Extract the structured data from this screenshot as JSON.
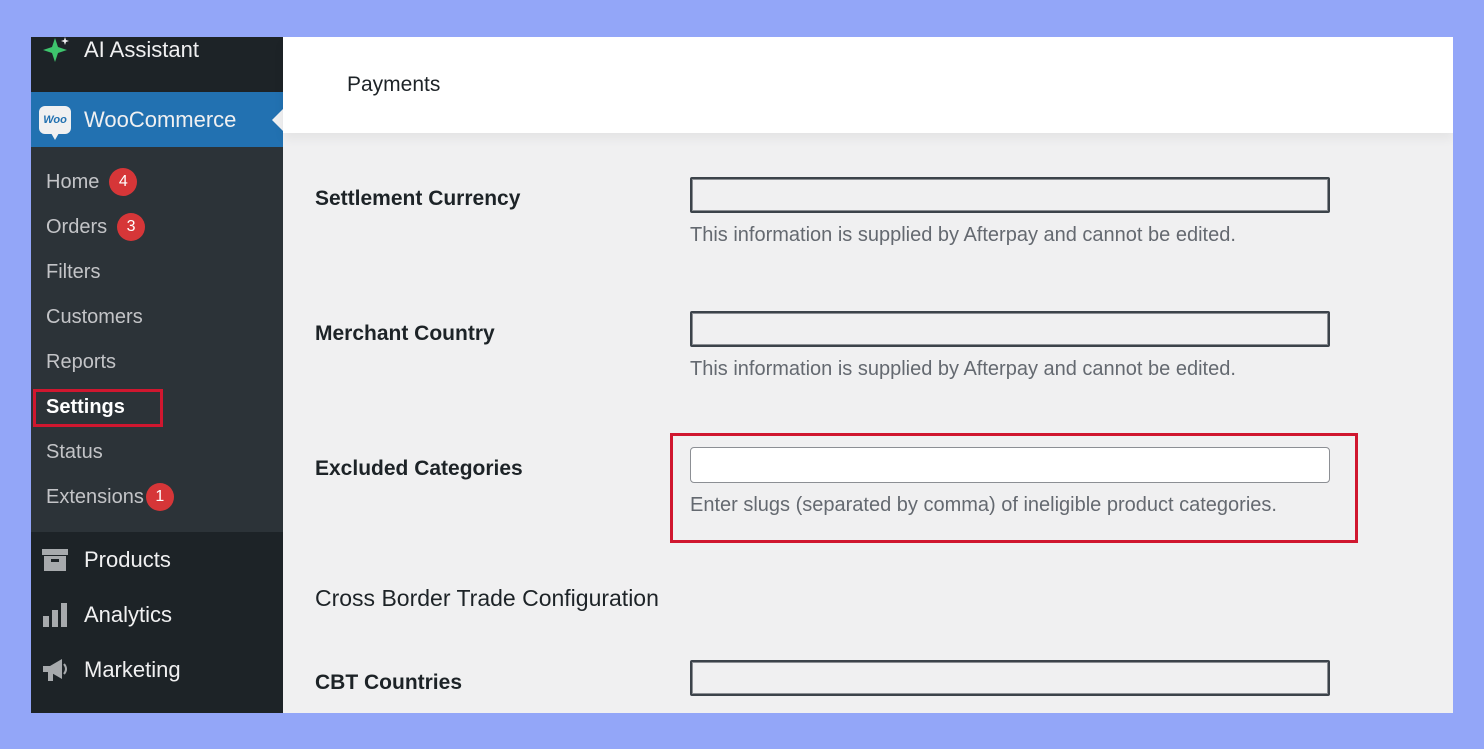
{
  "sidebar": {
    "ai_assistant": {
      "label": "AI Assistant",
      "icon": "sparkle-icon"
    },
    "woocommerce": {
      "label": "WooCommerce",
      "logo_text": "Woo"
    },
    "submenu": [
      {
        "label": "Home",
        "badge": "4"
      },
      {
        "label": "Orders",
        "badge": "3"
      },
      {
        "label": "Filters"
      },
      {
        "label": "Customers"
      },
      {
        "label": "Reports"
      },
      {
        "label": "Settings",
        "active": true
      },
      {
        "label": "Status"
      },
      {
        "label": "Extensions",
        "badge": "1"
      }
    ],
    "products": {
      "label": "Products",
      "icon": "archive-icon"
    },
    "analytics": {
      "label": "Analytics",
      "icon": "bar-chart-icon"
    },
    "marketing": {
      "label": "Marketing",
      "icon": "megaphone-icon"
    }
  },
  "header": {
    "title": "Payments"
  },
  "form": {
    "settlement_currency": {
      "label": "Settlement Currency",
      "value": "",
      "description": "This information is supplied by Afterpay and cannot be edited."
    },
    "merchant_country": {
      "label": "Merchant Country",
      "value": "",
      "description": "This information is supplied by Afterpay and cannot be edited."
    },
    "excluded_categories": {
      "label": "Excluded Categories",
      "value": "",
      "description": "Enter slugs (separated by comma) of ineligible product categories."
    },
    "cross_border_heading": "Cross Border Trade Configuration",
    "cbt_countries": {
      "label": "CBT Countries",
      "value": ""
    }
  },
  "colors": {
    "accent": "#2271b1",
    "highlight": "#d0172f",
    "badge": "#d63638",
    "sidebar_bg": "#1d2327",
    "background": "#93a6f8"
  }
}
